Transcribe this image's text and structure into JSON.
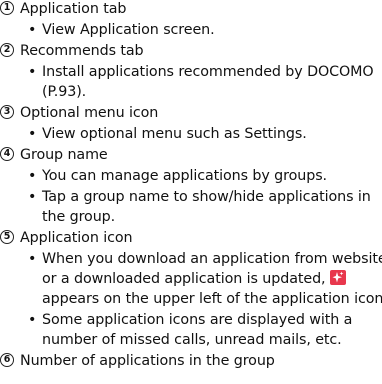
{
  "items": [
    {
      "number": "1",
      "title": "Application tab",
      "bullets": [
        {
          "lines": [
            "View Application screen."
          ]
        }
      ]
    },
    {
      "number": "2",
      "title": "Recommends tab",
      "bullets": [
        {
          "lines": [
            "Install applications recommended by DOCOMO",
            "(P.93)."
          ]
        }
      ]
    },
    {
      "number": "3",
      "title": "Optional menu icon",
      "bullets": [
        {
          "lines": [
            "View optional menu such as Settings."
          ]
        }
      ]
    },
    {
      "number": "4",
      "title": "Group name",
      "bullets": [
        {
          "lines": [
            "You can manage applications by groups."
          ]
        },
        {
          "lines": [
            "Tap a group name to show/hide applications in",
            "the group."
          ]
        }
      ]
    },
    {
      "number": "5",
      "title": "Application icon",
      "bullets": [
        {
          "lines": [
            "When you download an application from website",
            "or a downloaded application is updated,",
            "appears on the upper left of the application icon."
          ]
        },
        {
          "lines": [
            "Some application icons are displayed with a",
            "number of missed calls, unread mails, etc."
          ]
        }
      ]
    },
    {
      "number": "6",
      "title": "Number of applications in the group",
      "bullets": []
    }
  ],
  "bullet_glyph": "•",
  "update_badge_icon": "sparkle-new-icon",
  "colors": {
    "badge": "#e8374d",
    "text": "#111111"
  }
}
